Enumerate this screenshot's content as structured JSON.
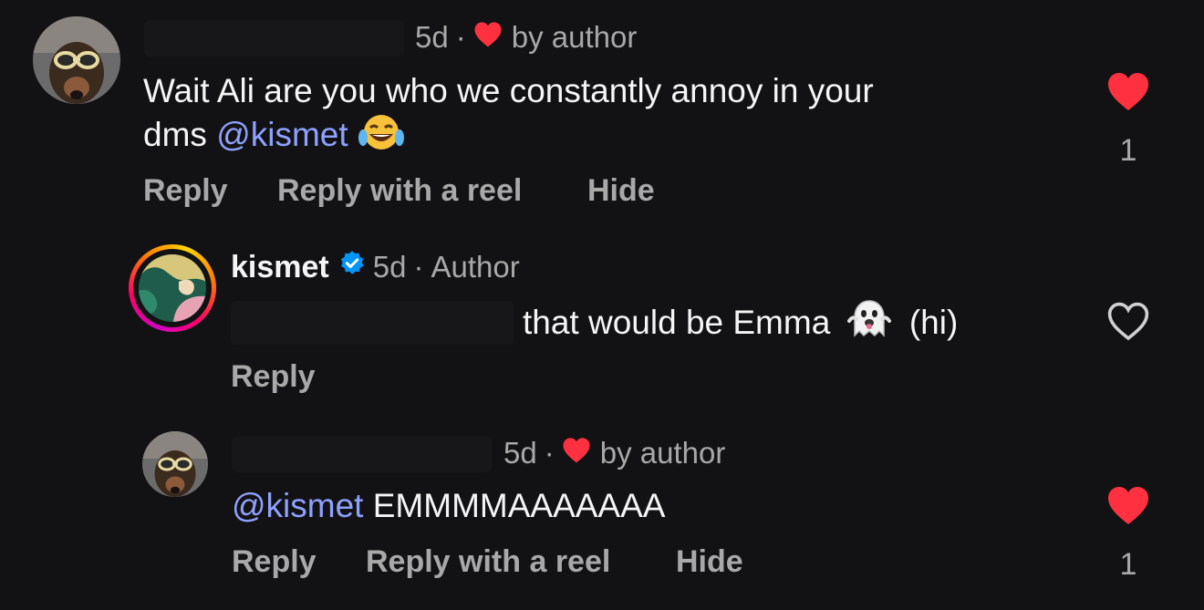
{
  "comments": [
    {
      "time": "5d",
      "separator": "·",
      "liked_by_author": "by author",
      "text_line1": "Wait Ali are you who we constantly annoy in your",
      "text_line2_prefix": "dms ",
      "mention": "@kismet",
      "emoji": "face-with-tears-of-joy",
      "actions": [
        "Reply",
        "Reply with a reel",
        "Hide"
      ],
      "like_count": "1",
      "liked": true
    },
    {
      "username": "kismet",
      "verified": true,
      "time": "5d",
      "separator": "·",
      "role": "Author",
      "text": "that would be Emma",
      "emoji": "ghost",
      "text_suffix": "(hi)",
      "actions": [
        "Reply"
      ],
      "liked": false
    },
    {
      "time": "5d",
      "separator": "·",
      "liked_by_author": "by author",
      "mention": "@kismet",
      "text": " EMMMMAAAAAAA",
      "actions": [
        "Reply",
        "Reply with a reel",
        "Hide"
      ],
      "like_count": "1",
      "liked": true
    }
  ],
  "colors": {
    "background": "#121214",
    "text": "#f5f5f5",
    "muted": "#a8a8a8",
    "mention": "#8ea1ff",
    "like_red": "#ff3040",
    "verified_blue": "#0095f6"
  }
}
